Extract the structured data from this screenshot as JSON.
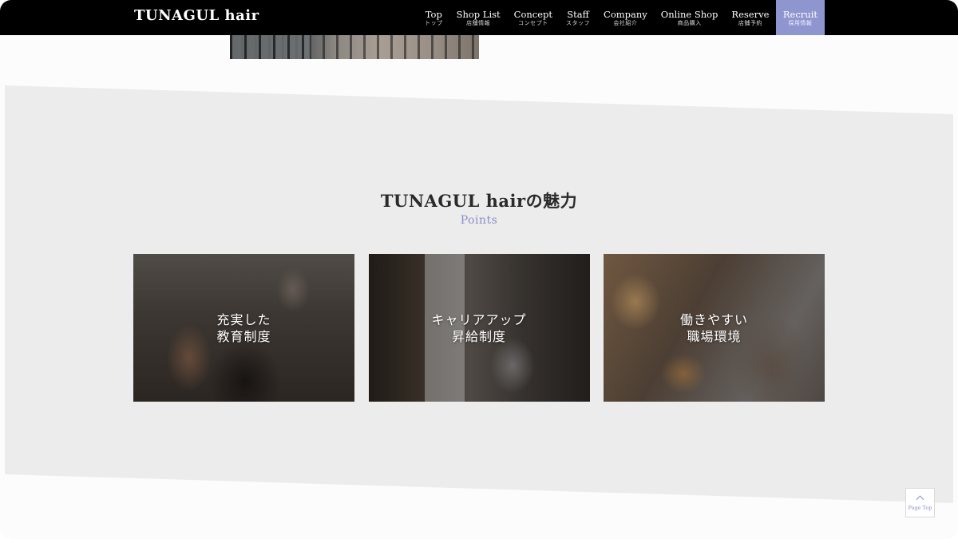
{
  "header": {
    "brand": "TUNAGUL hair",
    "nav": [
      {
        "en": "Top",
        "ja": "トップ"
      },
      {
        "en": "Shop List",
        "ja": "店舗情報"
      },
      {
        "en": "Concept",
        "ja": "コンセプト"
      },
      {
        "en": "Staff",
        "ja": "スタッフ"
      },
      {
        "en": "Company",
        "ja": "会社紹介"
      },
      {
        "en": "Online Shop",
        "ja": "商品購入"
      },
      {
        "en": "Reserve",
        "ja": "店舗予約"
      },
      {
        "en": "Recruit",
        "ja": "採用情報"
      }
    ],
    "active_nav": "Recruit",
    "active_color": "#8f95cf"
  },
  "points": {
    "title": "TUNAGUL hairの魅力",
    "subtitle": "Points",
    "accent_color": "#8a90c9",
    "cards": [
      {
        "line1": "充実した",
        "line2": "教育制度"
      },
      {
        "line1": "キャリアアップ",
        "line2": "昇給制度"
      },
      {
        "line1": "働きやすい",
        "line2": "職場環境"
      }
    ]
  },
  "page_top": {
    "label": "Page Top",
    "icon": "chevron-up-icon"
  }
}
